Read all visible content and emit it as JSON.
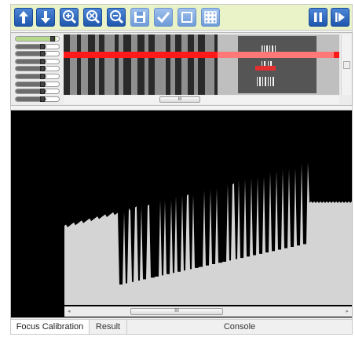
{
  "toolbar": {
    "buttons": [
      {
        "name": "move-up-button",
        "icon": "arrow-up-icon"
      },
      {
        "name": "move-down-button",
        "icon": "arrow-down-icon"
      },
      {
        "name": "zoom-in-button",
        "icon": "zoom-in-icon"
      },
      {
        "name": "zoom-reset-button",
        "icon": "zoom-fit-icon"
      },
      {
        "name": "zoom-out-button",
        "icon": "zoom-out-icon"
      },
      {
        "name": "save-button",
        "icon": "floppy-disk-icon"
      },
      {
        "name": "check-button",
        "icon": "checkmark-icon"
      },
      {
        "name": "frame-button",
        "icon": "square-icon"
      },
      {
        "name": "grid-button",
        "icon": "grid-icon"
      },
      {
        "name": "pause-button",
        "icon": "pause-icon"
      },
      {
        "name": "step-play-button",
        "icon": "step-play-icon"
      }
    ]
  },
  "thumbnail": {
    "slider_levels": [
      0.95,
      0.7,
      0.7,
      0.7,
      0.7,
      0.7,
      0.7,
      0.7,
      0.7
    ],
    "scroll_grip": "III"
  },
  "plot": {
    "scroll_grip": "III",
    "scroll_left": "◂",
    "scroll_right": "▸"
  },
  "tabs": [
    {
      "label": "Focus Calibration",
      "active": true
    },
    {
      "label": "Result",
      "active": false
    },
    {
      "label": "Console",
      "active": false
    }
  ],
  "colors": {
    "toolbar_bg": "#eaf3c8",
    "button_blue": "#2a62b8",
    "scanline_red": "#ff1a1a",
    "signal_gray": "#d4d4d4",
    "plot_bg": "#000000"
  }
}
